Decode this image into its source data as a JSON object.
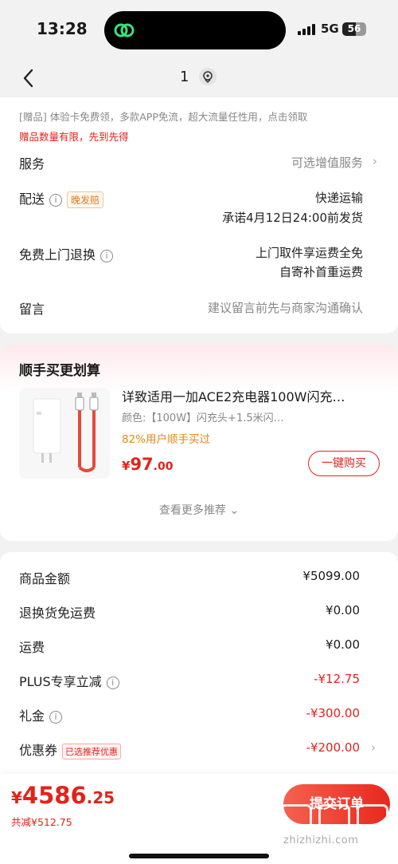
{
  "status": {
    "time": "13:28",
    "network": "5G",
    "battery": "56"
  },
  "nav": {
    "count": "1"
  },
  "promo": {
    "line1": "[赠品] 体验卡免费领，多款APP免流，超大流量任性用，点击领取",
    "line2": "赠品数量有限，先到先得"
  },
  "service": {
    "label": "服务",
    "value": "可选增值服务"
  },
  "delivery": {
    "label": "配送",
    "tag": "晚发赔",
    "method": "快递运输",
    "promise": "承诺4月12日24:00前发货"
  },
  "returns": {
    "label": "免费上门退换",
    "line1": "上门取件享运费全免",
    "line2": "自寄补首重运费"
  },
  "note": {
    "label": "留言",
    "placeholder": "建议留言前先与商家沟通确认"
  },
  "recommend": {
    "title": "顺手买更划算",
    "product_name": "详致适用一加ACE2充电器100W闪充…",
    "spec": "颜色:【100W】闪充头+1.5米闪…",
    "rate": "82%用户顺手买过",
    "price_symbol": "¥",
    "price_int": "97",
    "price_dec": ".00",
    "buy_label": "一键购买",
    "more_label": "查看更多推荐"
  },
  "costs": [
    {
      "label": "商品金额",
      "value": "¥5099.00"
    },
    {
      "label": "退换货免运费",
      "value": "¥0.00"
    },
    {
      "label": "运费",
      "value": "¥0.00"
    },
    {
      "label": "PLUS专享立减",
      "value": "-¥12.75"
    },
    {
      "label": "礼金",
      "value": "-¥300.00"
    },
    {
      "label": "优惠券",
      "tag": "已选推荐优惠",
      "value": "-¥200.00"
    }
  ],
  "footer": {
    "total_symbol": "¥",
    "total_int": "4586",
    "total_dec": ".25",
    "saving": "共减¥512.75",
    "submit_label": "提交订单",
    "watermark": "zhizhizhi.com"
  },
  "colors": {
    "accent": "#e2231a",
    "orange": "#e07a1f",
    "background": "#f2f2f2"
  }
}
